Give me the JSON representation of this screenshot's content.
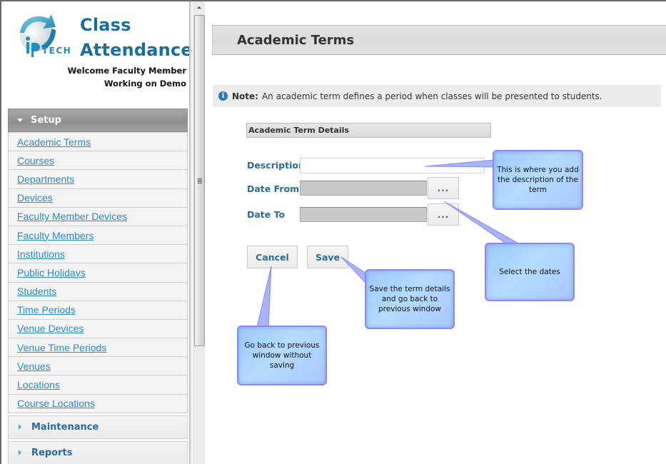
{
  "app": {
    "title_line1": "Class",
    "title_line2": "Attendance",
    "logo_text": "TECH",
    "welcome": "Welcome Faculty Member",
    "working_on": "Working on Demo"
  },
  "sidebar": {
    "sections": [
      {
        "label": "Setup",
        "expanded": true,
        "items": [
          {
            "label": "Academic Terms"
          },
          {
            "label": "Courses"
          },
          {
            "label": "Departments"
          },
          {
            "label": "Devices"
          },
          {
            "label": "Faculty Member Devices"
          },
          {
            "label": "Faculty Members"
          },
          {
            "label": "Institutions"
          },
          {
            "label": "Public Holidays"
          },
          {
            "label": "Students"
          },
          {
            "label": "Time Periods"
          },
          {
            "label": "Venue Devices"
          },
          {
            "label": "Venue Time Periods"
          },
          {
            "label": "Venues"
          },
          {
            "label": "Locations"
          },
          {
            "label": "Course Locations"
          }
        ]
      },
      {
        "label": "Maintenance",
        "expanded": false
      },
      {
        "label": "Reports",
        "expanded": false
      }
    ]
  },
  "main": {
    "page_title": "Academic Terms",
    "note_label": "Note:",
    "note_text": "An academic term defines a period when classes will be presented to students.",
    "section_title": "Academic Term Details",
    "fields": {
      "description": {
        "label": "Description",
        "value": ""
      },
      "date_from": {
        "label": "Date From",
        "value": "",
        "picker_label": "..."
      },
      "date_to": {
        "label": "Date To",
        "value": "",
        "picker_label": "..."
      }
    },
    "buttons": {
      "cancel": "Cancel",
      "save": "Save"
    }
  },
  "callouts": {
    "description": "This is where you add the description of the term",
    "dates": "Select the dates",
    "save": "Save the term details and go back to previous window",
    "cancel": "Go back to previous window without saving"
  },
  "colors": {
    "brand": "#1b6e9c",
    "link": "#2a8bc7",
    "label": "#2a6b9a",
    "callout_fill": "#b3dcff",
    "callout_border": "#8a8af0"
  }
}
